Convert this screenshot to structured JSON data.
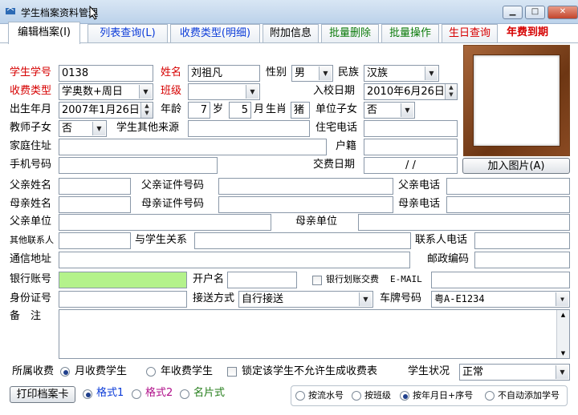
{
  "window": {
    "title": "学生档案资料管理",
    "minimize": "▁",
    "maximize": "□",
    "close": "✕"
  },
  "tabs": [
    {
      "label": "编辑档案(I)",
      "color": "#000000"
    },
    {
      "label": "列表查询(L)",
      "color": "#0b3bd8"
    },
    {
      "label": "收费类型(明细)",
      "color": "#0b3bd8"
    },
    {
      "label": "附加信息",
      "color": "#000000"
    },
    {
      "label": "批量删除",
      "color": "#0a7a0a"
    },
    {
      "label": "批量操作",
      "color": "#0a7a0a"
    },
    {
      "label": "生日查询",
      "color": "#d60000"
    },
    {
      "label": "年费到期",
      "color": "#d60000"
    }
  ],
  "labels": {
    "student_no": "学生学号",
    "name": "姓名",
    "gender": "性别",
    "ethnicity": "民族",
    "fee_type": "收费类型",
    "class": "班级",
    "enroll_date": "入校日期",
    "birth_date": "出生年月",
    "age": "年龄",
    "age_unit_year": "岁",
    "age_unit_month": "月",
    "zodiac": "生肖",
    "work_unit_child": "单位子女",
    "teacher_child": "教师子女",
    "other_source": "学生其他来源",
    "home_phone": "住宅电话",
    "home_address": "家庭住址",
    "hukou": "户籍",
    "mobile": "手机号码",
    "pay_date": "交费日期",
    "father_name": "父亲姓名",
    "father_id": "父亲证件号码",
    "father_phone": "父亲电话",
    "mother_name": "母亲姓名",
    "mother_id": "母亲证件号码",
    "mother_phone": "母亲电话",
    "father_unit": "父亲单位",
    "mother_unit": "母亲单位",
    "other_contact": "其他联系人",
    "relation": "与学生关系",
    "contact_phone": "联系人电话",
    "address": "通信地址",
    "postcode": "邮政编码",
    "bank_account": "银行账号",
    "account_name": "开户名",
    "bank_debit": "银行划账交费",
    "email": "E-MAIL",
    "id_no": "身份证号",
    "transport": "接送方式",
    "plate": "车牌号码",
    "remarks": "备　注",
    "fee_group": "所属收费",
    "student_status": "学生状况"
  },
  "values": {
    "student_no": "0138",
    "name": "刘祖凡",
    "gender": "男",
    "ethnicity": "汉族",
    "fee_type": "学奥数+周日",
    "class": "",
    "enroll_date": "2010年6月26日",
    "birth_date": "2007年1月26日",
    "age_year": "7",
    "age_month": "5",
    "zodiac": "猪",
    "work_unit_child": "否",
    "teacher_child": "否",
    "pay_date": "/   /",
    "transport": "自行接送",
    "plate": "粤A-E1234",
    "student_status": "正常"
  },
  "buttons": {
    "add_photo": "加入图片(A)",
    "print_card": "打印档案卡"
  },
  "options": {
    "monthly": "月收费学生",
    "yearly": "年收费学生",
    "lock": "锁定该学生不允许生成收费表",
    "format1": "格式1",
    "format2": "格式2",
    "name_card": "名片式",
    "by_serial": "按流水号",
    "by_class": "按班级",
    "by_birth": "按年月日+序号",
    "no_auto": "不自动添加学号"
  }
}
